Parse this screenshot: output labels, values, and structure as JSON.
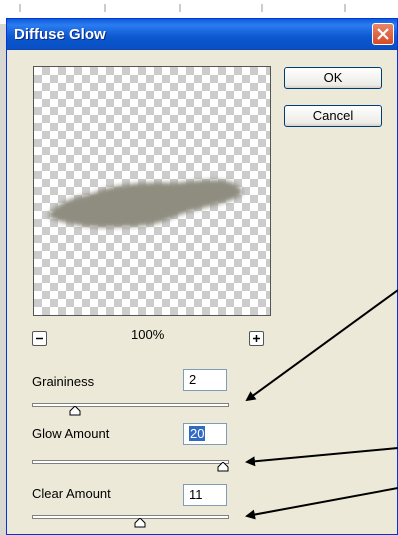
{
  "dialog": {
    "title": "Diffuse Glow"
  },
  "buttons": {
    "ok_label": "OK",
    "cancel_label": "Cancel"
  },
  "zoom": {
    "level": "100%",
    "out_icon": "minus-icon",
    "in_icon": "plus-icon"
  },
  "controls": [
    {
      "label": "Graininess",
      "value": "2",
      "min": 0,
      "max": 10,
      "selected": false
    },
    {
      "label": "Glow Amount",
      "value": "20",
      "min": 0,
      "max": 20,
      "selected": true
    },
    {
      "label": "Clear Amount",
      "value": "11",
      "min": 0,
      "max": 20,
      "selected": false
    }
  ],
  "colors": {
    "titlebar": "#0a5ed8",
    "dialog_bg": "#ece9d8",
    "close_button": "#d64b25",
    "selection": "#316ac5",
    "glow_shape": "#8f8d80"
  }
}
